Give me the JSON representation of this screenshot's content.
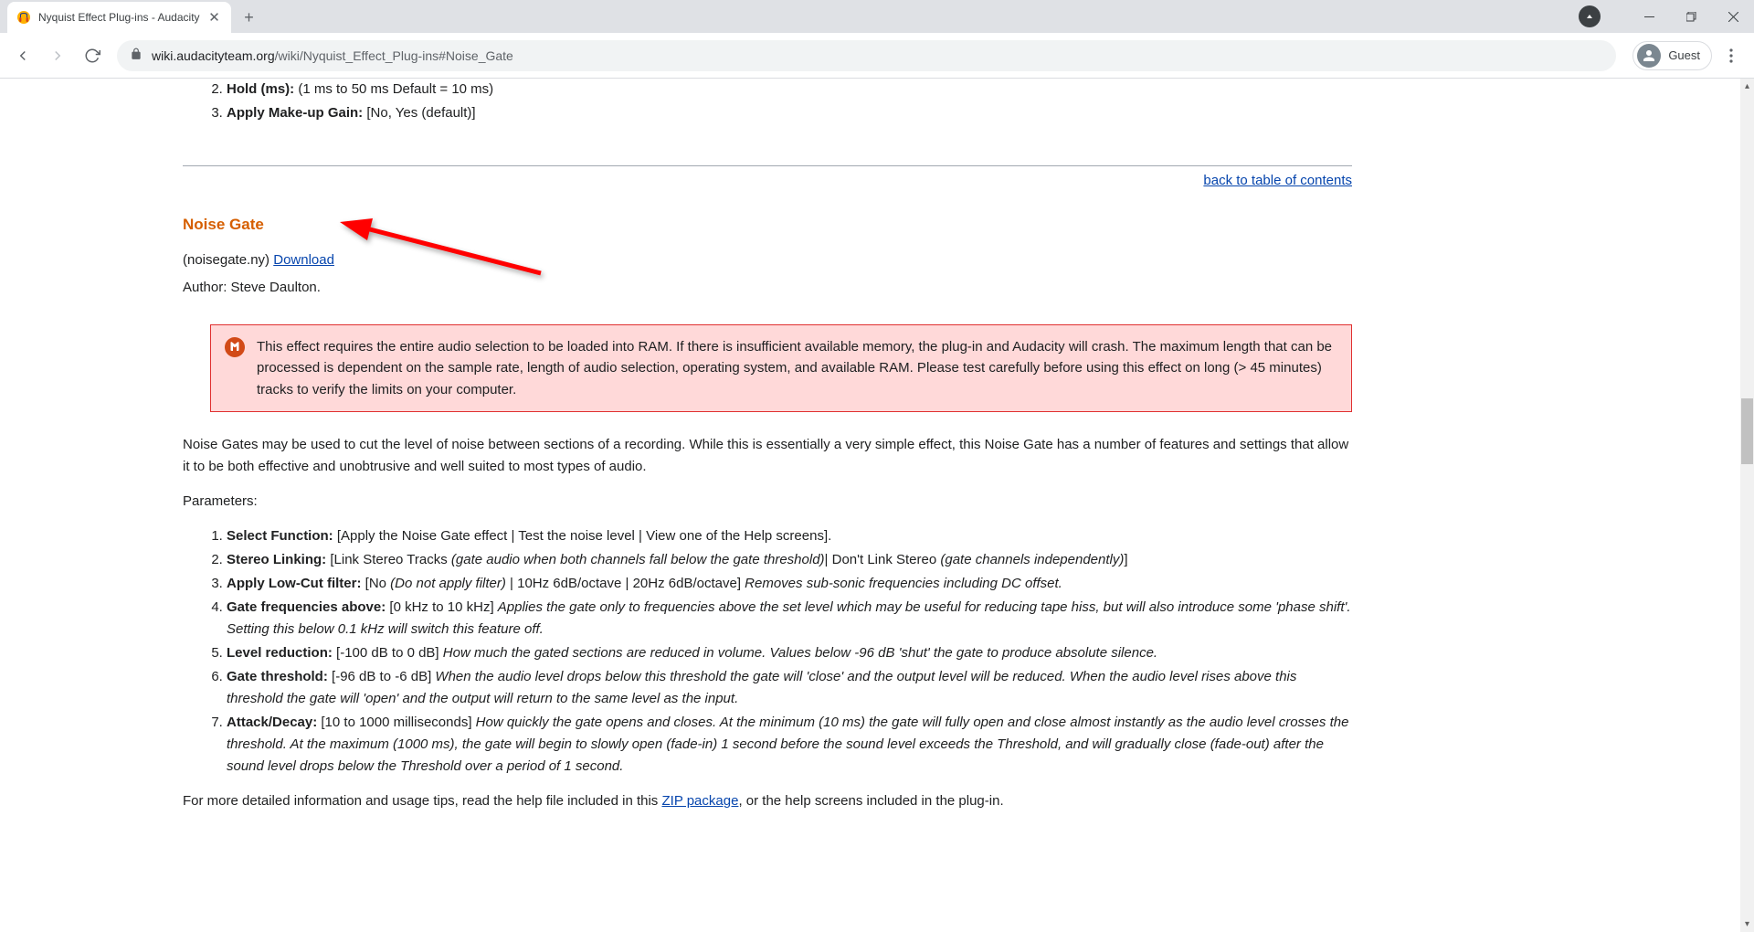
{
  "browser": {
    "tab_title": "Nyquist Effect Plug-ins - Audacity",
    "url_domain": "wiki.audacityteam.org",
    "url_path": "/wiki/Nyquist_Effect_Plug-ins#Noise_Gate",
    "guest_label": "Guest"
  },
  "upper_list": {
    "start": 2,
    "items": [
      {
        "label": "Hold (ms):",
        "desc": "(1 ms to 50 ms Default = 10 ms)"
      },
      {
        "label": "Apply Make-up Gain:",
        "desc": "[No, Yes (default)]"
      }
    ]
  },
  "toc_link": "back to table of contents",
  "section_title": "Noise Gate",
  "filename_prefix": "(noisegate.ny) ",
  "download_label": "Download",
  "author_line": "Author: Steve Daulton.",
  "warning_text": "This effect requires the entire audio selection to be loaded into RAM. If there is insufficient available memory, the plug-in and Audacity will crash. The maximum length that can be processed is dependent on the sample rate, length of audio selection, operating system, and available RAM. Please test carefully before using this effect on long (> 45 minutes) tracks to verify the limits on your computer.",
  "intro_para": "Noise Gates may be used to cut the level of noise between sections of a recording. While this is essentially a very simple effect, this Noise Gate has a number of features and settings that allow it to be both effective and unobtrusive and well suited to most types of audio.",
  "parameters_label": "Parameters:",
  "params": [
    {
      "label": "Select Function:",
      "text": " [Apply the Noise Gate effect | Test the noise level | View one of the Help screens]."
    },
    {
      "label": "Stereo Linking:",
      "text_before": " [Link Stereo Tracks ",
      "italic1": "(gate audio when both channels fall below the gate threshold)",
      "text_mid": "| Don't Link Stereo ",
      "italic2": "(gate channels independently)",
      "text_after": "]"
    },
    {
      "label": "Apply Low-Cut filter:",
      "text_before": " [No ",
      "italic1": "(Do not apply filter)",
      "text_mid": " | 10Hz 6dB/octave | 20Hz 6dB/octave] ",
      "italic2": "Removes sub-sonic frequencies including DC offset.",
      "text_after": ""
    },
    {
      "label": "Gate frequencies above:",
      "text_before": " [0 kHz to 10 kHz] ",
      "italic1": "Applies the gate only to frequencies above the set level which may be useful for reducing tape hiss, but will also introduce some 'phase shift'. Setting this below 0.1 kHz will switch this feature off.",
      "text_mid": "",
      "italic2": "",
      "text_after": ""
    },
    {
      "label": "Level reduction:",
      "text_before": " [-100 dB to 0 dB] ",
      "italic1": "How much the gated sections are reduced in volume. Values below -96 dB 'shut' the gate to produce absolute silence.",
      "text_mid": "",
      "italic2": "",
      "text_after": ""
    },
    {
      "label": "Gate threshold:",
      "text_before": " [-96 dB to -6 dB] ",
      "italic1": "When the audio level drops below this threshold the gate will 'close' and the output level will be reduced. When the audio level rises above this threshold the gate will 'open' and the output will return to the same level as the input.",
      "text_mid": "",
      "italic2": "",
      "text_after": ""
    },
    {
      "label": "Attack/Decay:",
      "text_before": " [10 to 1000 milliseconds] ",
      "italic1": "How quickly the gate opens and closes. At the minimum (10 ms) the gate will fully open and close almost instantly as the audio level crosses the threshold. At the maximum (1000 ms), the gate will begin to slowly open (fade-in) 1 second before the sound level exceeds the Threshold, and will gradually close (fade-out) after the sound level drops below the Threshold over a period of 1 second.",
      "text_mid": "",
      "italic2": "",
      "text_after": ""
    }
  ],
  "more_info_before": "For more detailed information and usage tips, read the help file included in this ",
  "zip_label": "ZIP package",
  "more_info_after": ", or the help screens included in the plug-in."
}
